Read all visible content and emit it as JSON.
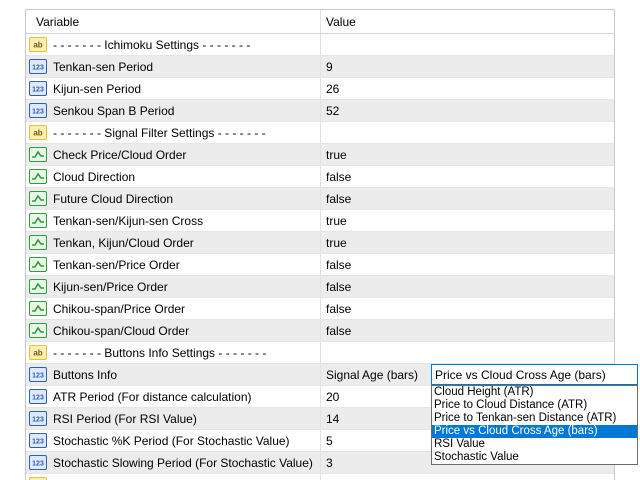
{
  "header": {
    "variable": "Variable",
    "value": "Value"
  },
  "rows": [
    {
      "icon": "ab-string-icon",
      "name": "- - - - - - - Ichimoku Settings - - - - - - -",
      "value": ""
    },
    {
      "icon": "123-integer-icon",
      "name": "Tenkan-sen Period",
      "value": "9"
    },
    {
      "icon": "123-integer-icon",
      "name": "Kijun-sen Period",
      "value": "26"
    },
    {
      "icon": "123-integer-icon",
      "name": "Senkou Span B Period",
      "value": "52"
    },
    {
      "icon": "ab-string-icon",
      "name": "- - - - - - - Signal Filter Settings - - - - - - -",
      "value": ""
    },
    {
      "icon": "boolean-icon",
      "name": "Check Price/Cloud Order",
      "value": "true"
    },
    {
      "icon": "boolean-icon",
      "name": "Cloud Direction",
      "value": "false"
    },
    {
      "icon": "boolean-icon",
      "name": "Future Cloud Direction",
      "value": "false"
    },
    {
      "icon": "boolean-icon",
      "name": "Tenkan-sen/Kijun-sen Cross",
      "value": "true"
    },
    {
      "icon": "boolean-icon",
      "name": "Tenkan, Kijun/Cloud Order",
      "value": "true"
    },
    {
      "icon": "boolean-icon",
      "name": "Tenkan-sen/Price Order",
      "value": "false"
    },
    {
      "icon": "boolean-icon",
      "name": "Kijun-sen/Price Order",
      "value": "false"
    },
    {
      "icon": "boolean-icon",
      "name": "Chikou-span/Price Order",
      "value": "false"
    },
    {
      "icon": "boolean-icon",
      "name": "Chikou-span/Cloud Order",
      "value": "false"
    },
    {
      "icon": "ab-string-icon",
      "name": "- - - - - - - Buttons Info Settings - - - - - - -",
      "value": ""
    },
    {
      "icon": "123-integer-icon",
      "name": "Buttons Info",
      "value": "Signal Age (bars)"
    },
    {
      "icon": "123-integer-icon",
      "name": "ATR Period (For distance calculation)",
      "value": "20"
    },
    {
      "icon": "123-integer-icon",
      "name": "RSI Period (For RSI Value)",
      "value": "14"
    },
    {
      "icon": "123-integer-icon",
      "name": "Stochastic %K Period (For Stochastic Value)",
      "value": "5"
    },
    {
      "icon": "123-integer-icon",
      "name": "Stochastic Slowing Period (For Stochastic Value)",
      "value": "3"
    },
    {
      "icon": "ab-string-icon",
      "name": "",
      "value": ""
    }
  ],
  "combo": {
    "selected": "Price vs Cloud Cross Age (bars)",
    "options": [
      "Cloud Height (ATR)",
      "Price to Cloud Distance (ATR)",
      "Price to Tenkan-sen Distance (ATR)",
      "Price vs Cloud Cross Age (bars)",
      "RSI Value",
      "Stochastic Value"
    ],
    "highlighted_index": 3
  },
  "colors": {
    "selection": "#0078d7",
    "alt_row": "#ececec",
    "bool_icon_green": "#2e9e3a",
    "int_icon_blue": "#2b62b8",
    "string_icon_yellow": "#e8c33a"
  }
}
